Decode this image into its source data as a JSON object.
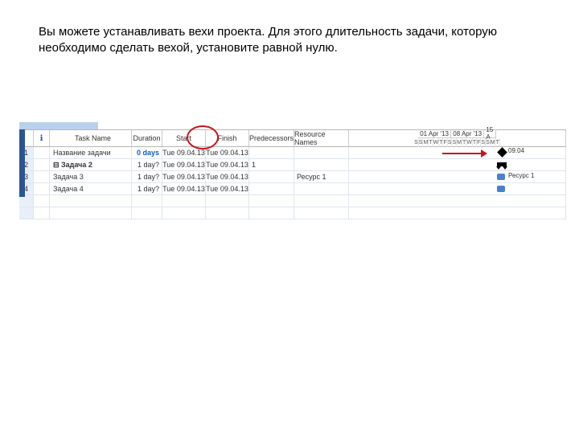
{
  "instruction": "Вы можете устанавливать вехи проекта. Для этого длительность задачи, которую необходимо сделать вехой, установите равной нулю.",
  "headers": {
    "info": "ℹ",
    "name": "Task Name",
    "duration": "Duration",
    "start": "Start",
    "finish": "Finish",
    "pred": "Predecessors",
    "res": "Resource Names"
  },
  "weeks": [
    "01 Apr '13",
    "08 Apr '13",
    "15 A"
  ],
  "days": [
    "S",
    "S",
    "M",
    "T",
    "W",
    "T",
    "F",
    "S",
    "S",
    "M",
    "T",
    "W",
    "T",
    "F",
    "S",
    "S",
    "M",
    "T"
  ],
  "rows": [
    {
      "id": "1",
      "name": "Название задачи",
      "dur": "0 days",
      "start": "Tue 09.04.13",
      "fin": "Tue 09.04.13",
      "pred": "",
      "res": "",
      "dur_blue": true,
      "ms": true,
      "ms_label": "09.04"
    },
    {
      "id": "2",
      "name": "⊟ Задача 2",
      "dur": "1 day?",
      "start": "Tue 09.04.13",
      "fin": "Tue 09.04.13",
      "pred": "1",
      "res": "",
      "summary": true
    },
    {
      "id": "3",
      "name": "   Задача 3",
      "dur": "1 day?",
      "start": "Tue 09.04.13",
      "fin": "Tue 09.04.13",
      "pred": "",
      "res": "Ресурс 1",
      "bar": true,
      "bar_res": "Ресурс 1"
    },
    {
      "id": "4",
      "name": "   Задача 4",
      "dur": "1 day?",
      "start": "Tue 09.04.13",
      "fin": "Tue 09.04.13",
      "pred": "",
      "res": "",
      "bar": true
    }
  ]
}
